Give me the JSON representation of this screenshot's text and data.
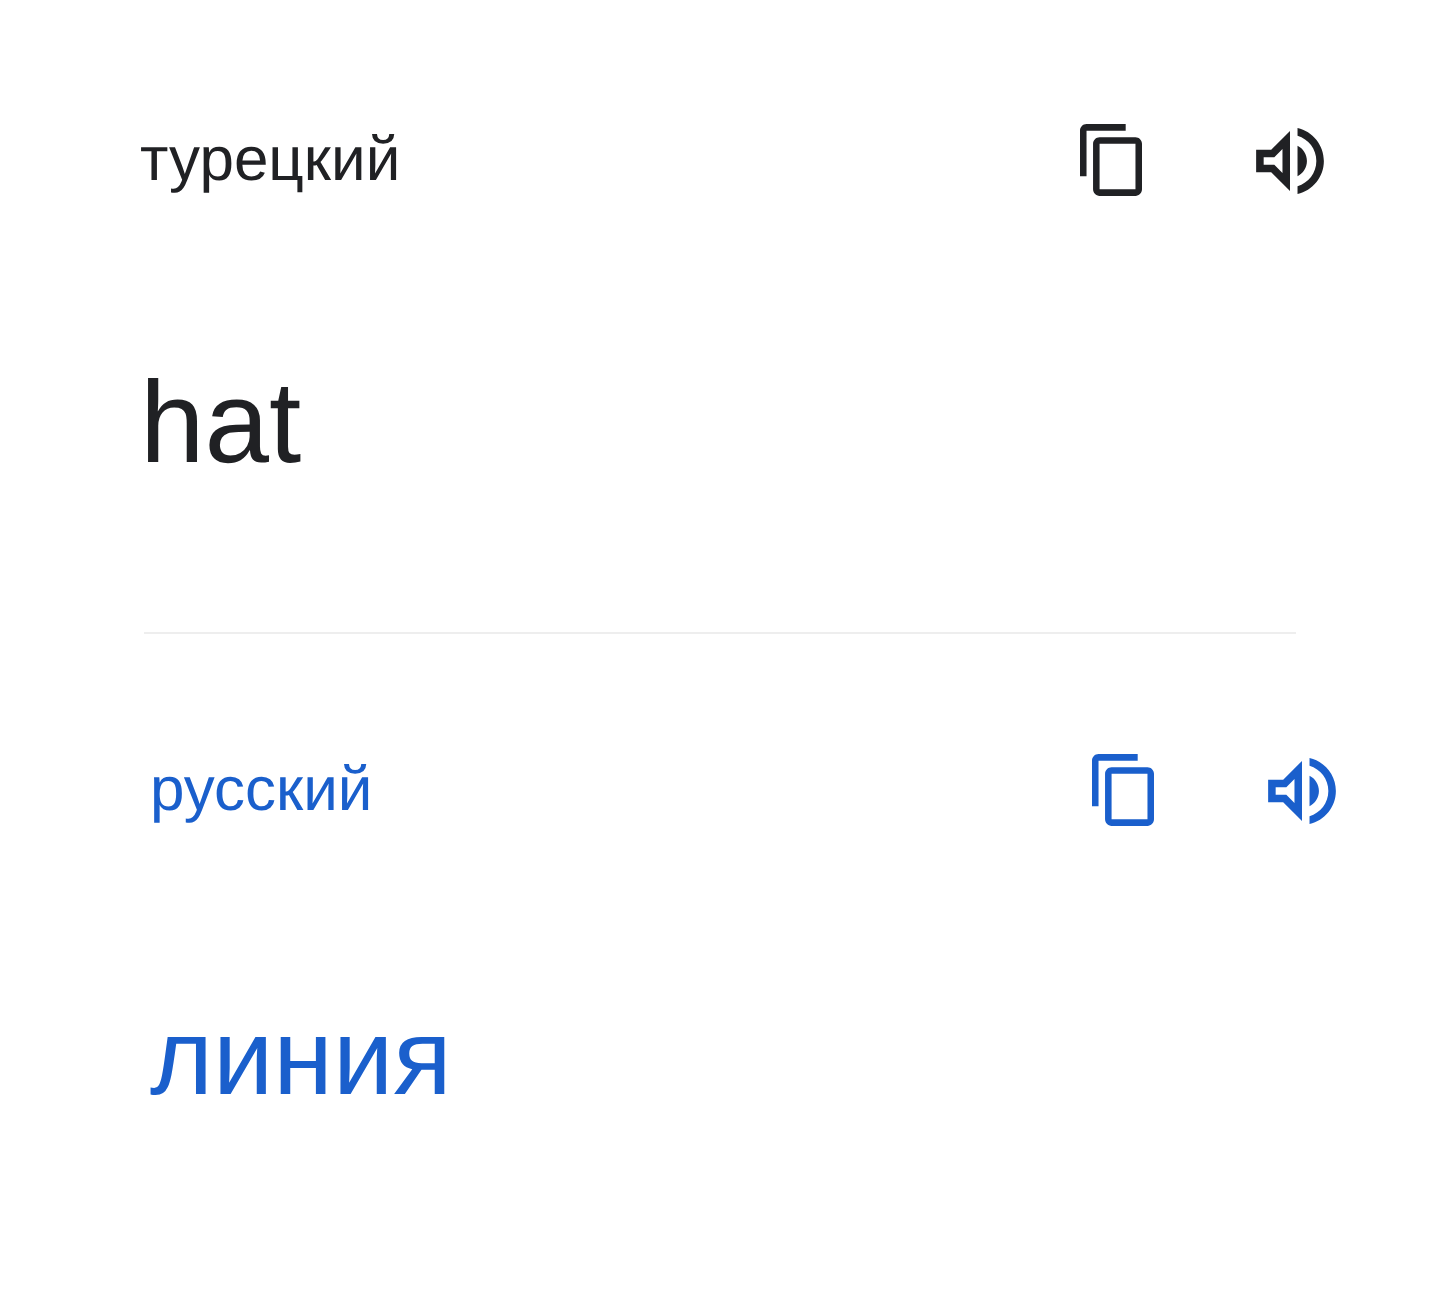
{
  "panels": [
    {
      "kind": "source",
      "language": "турецкий",
      "text": "hat"
    },
    {
      "kind": "target",
      "language": "русский",
      "text": "линия"
    }
  ]
}
